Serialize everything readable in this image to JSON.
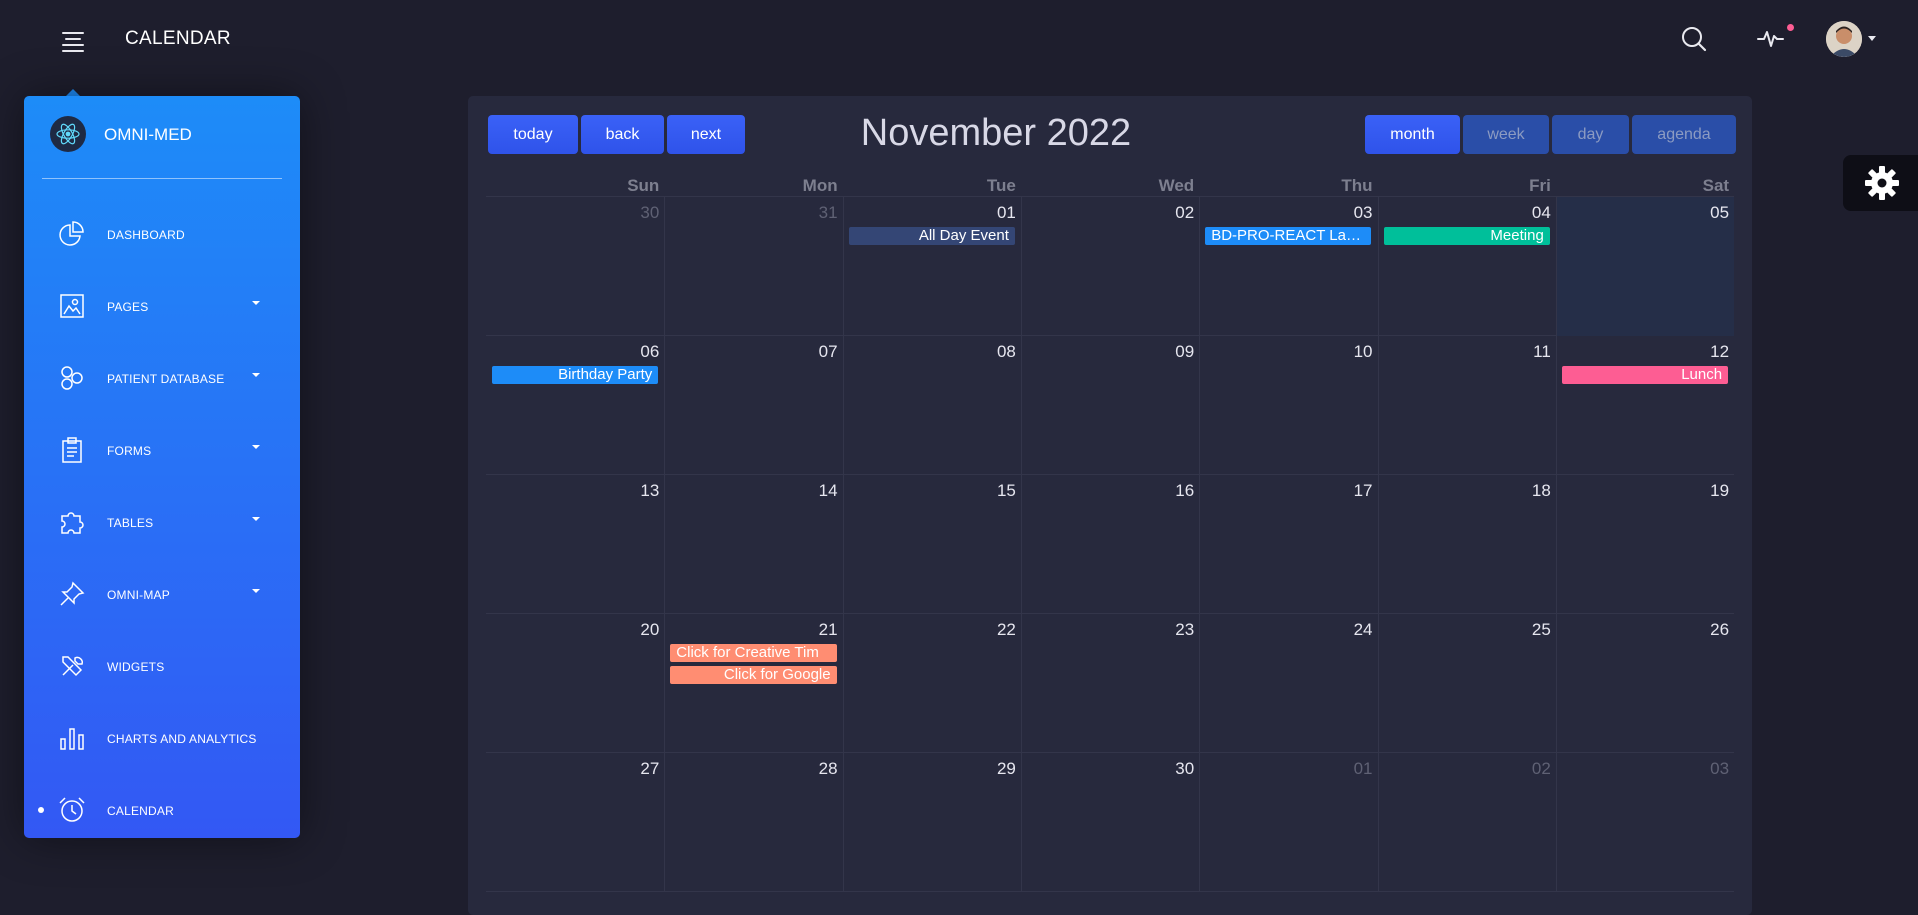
{
  "header": {
    "title": "CALENDAR",
    "icons": [
      "menu-icon",
      "search-icon",
      "activity-icon",
      "avatar",
      "caret-down-icon"
    ],
    "notification_color": "#fd5d93"
  },
  "sidebar": {
    "brand": "OMNI-MED",
    "gradient": [
      "#1d8cf8",
      "#3358f4"
    ],
    "items": [
      {
        "label": "DASHBOARD",
        "icon": "pie-chart-icon",
        "caret": false
      },
      {
        "label": "PAGES",
        "icon": "image-icon",
        "caret": true
      },
      {
        "label": "PATIENT DATABASE",
        "icon": "hexagons-icon",
        "caret": true
      },
      {
        "label": "FORMS",
        "icon": "clipboard-icon",
        "caret": true
      },
      {
        "label": "TABLES",
        "icon": "puzzle-icon",
        "caret": true
      },
      {
        "label": "OMNI-MAP",
        "icon": "pin-icon",
        "caret": true
      },
      {
        "label": "WIDGETS",
        "icon": "tools-icon",
        "caret": false
      },
      {
        "label": "CHARTS AND ANALYTICS",
        "icon": "bar-chart-icon",
        "caret": false
      },
      {
        "label": "CALENDAR",
        "icon": "alarm-clock-icon",
        "caret": false,
        "active": true
      }
    ]
  },
  "calendar": {
    "nav_buttons": {
      "today": "today",
      "back": "back",
      "next": "next"
    },
    "month_label": "November 2022",
    "views": {
      "month": "month",
      "week": "week",
      "day": "day",
      "agenda": "agenda"
    },
    "active_view": "month",
    "weekdays": [
      "Sun",
      "Mon",
      "Tue",
      "Wed",
      "Thu",
      "Fri",
      "Sat"
    ],
    "weeks": [
      [
        {
          "d": "30",
          "off": true
        },
        {
          "d": "31",
          "off": true
        },
        {
          "d": "01"
        },
        {
          "d": "02"
        },
        {
          "d": "03"
        },
        {
          "d": "04"
        },
        {
          "d": "05",
          "today": true
        }
      ],
      [
        {
          "d": "06"
        },
        {
          "d": "07"
        },
        {
          "d": "08"
        },
        {
          "d": "09"
        },
        {
          "d": "10"
        },
        {
          "d": "11"
        },
        {
          "d": "12"
        }
      ],
      [
        {
          "d": "13"
        },
        {
          "d": "14"
        },
        {
          "d": "15"
        },
        {
          "d": "16"
        },
        {
          "d": "17"
        },
        {
          "d": "18"
        },
        {
          "d": "19"
        }
      ],
      [
        {
          "d": "20"
        },
        {
          "d": "21"
        },
        {
          "d": "22"
        },
        {
          "d": "23"
        },
        {
          "d": "24"
        },
        {
          "d": "25"
        },
        {
          "d": "26"
        }
      ],
      [
        {
          "d": "27"
        },
        {
          "d": "28"
        },
        {
          "d": "29"
        },
        {
          "d": "30"
        },
        {
          "d": "01",
          "off": true
        },
        {
          "d": "02",
          "off": true
        },
        {
          "d": "03",
          "off": true
        }
      ]
    ],
    "events": [
      {
        "title": "All Day Event",
        "week": 0,
        "day": 2,
        "slot": 0,
        "color": "#344675",
        "align": "right"
      },
      {
        "title": "BD-PRO-REACT Launch",
        "week": 0,
        "day": 4,
        "slot": 0,
        "color": "#1d8cf8",
        "align": "left"
      },
      {
        "title": "Meeting",
        "week": 0,
        "day": 5,
        "slot": 0,
        "color": "#00bf9a",
        "align": "right"
      },
      {
        "title": "Birthday Party",
        "week": 1,
        "day": 0,
        "slot": 0,
        "color": "#1d8cf8",
        "align": "right"
      },
      {
        "title": "Lunch",
        "week": 1,
        "day": 6,
        "slot": 0,
        "color": "#fd5d93",
        "align": "right"
      },
      {
        "title": "Click for Creative Tim",
        "week": 3,
        "day": 1,
        "slot": 0,
        "color": "#ff8d72",
        "align": "left"
      },
      {
        "title": "Click for Google",
        "week": 3,
        "day": 1,
        "slot": 1,
        "color": "#ff8d72",
        "align": "right"
      }
    ]
  },
  "settings": {
    "icon": "gear-icon"
  }
}
